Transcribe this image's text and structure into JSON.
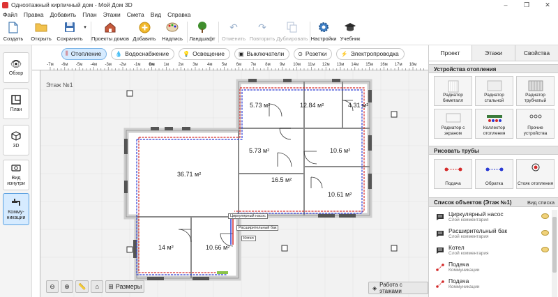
{
  "window": {
    "title": "Одноэтажный кирпичный дом - Мой Дом 3D",
    "controls": [
      "–",
      "❐",
      "✕"
    ]
  },
  "menu": [
    "Файл",
    "Правка",
    "Добавить",
    "План",
    "Этажи",
    "Смета",
    "Вид",
    "Справка"
  ],
  "toolbar": {
    "create": "Создать",
    "open": "Открыть",
    "save": "Сохранить",
    "house_projects": "Проекты домов",
    "add": "Добавить",
    "label": "Надпись",
    "landscape": "Ландшафт",
    "undo": "Отменить",
    "redo": "Повторить",
    "duplicate": "Дублировать",
    "settings": "Настройки",
    "tutorial": "Учебник"
  },
  "leftnav": {
    "overview": "Обзор",
    "plan": "План",
    "view3d": "3D",
    "view_inside": "Вид изнутри",
    "communications": "Комму-никации"
  },
  "categories": [
    "Отопление",
    "Водоснабжение",
    "Освещение",
    "Выключатели",
    "Розетки",
    "Электропроводка"
  ],
  "canvas": {
    "floor_label": "Этаж №1",
    "ruler_labels": [
      "-7м",
      "-6м",
      "-5м",
      "-4м",
      "-3м",
      "-2м",
      "-1м",
      "0м",
      "1м",
      "2м",
      "3м",
      "4м",
      "5м",
      "6м",
      "7м",
      "8м",
      "9м",
      "10м",
      "11м",
      "12м",
      "13м",
      "14м",
      "15м",
      "16м",
      "17м",
      "18м"
    ],
    "rooms": [
      "5.73 м²",
      "12.84 м²",
      "4.31 м²",
      "36.71 м²",
      "5.73 м²",
      "10.6 м²",
      "16.5 м²",
      "10.61 м²",
      "14 м²",
      "10.66 м²"
    ],
    "tags": [
      "Циркулярный насос",
      "Расширительный бак",
      "Котел"
    ],
    "sizes_button": "Размеры",
    "floors_button": "Работа с этажами"
  },
  "rpanel": {
    "tabs": [
      "Проект",
      "Этажи",
      "Свойства"
    ],
    "heating_header": "Устройства отопления",
    "heating_tiles": [
      "Радиатор биметалл",
      "Радиатор стальной",
      "Радиатор трубчатый",
      "Радиатор с экраном",
      "Коллектор отопления",
      "Прочие устройства"
    ],
    "pipes_header": "Рисовать трубы",
    "pipes_tiles": [
      "Подача",
      "Обратка",
      "Стояк отопления"
    ],
    "objects_header": "Список объектов (Этаж №1)",
    "objects_view": "Вид списка",
    "objects": [
      {
        "name": "Циркулярный насос",
        "sub": "Слой комментария"
      },
      {
        "name": "Расширительный бак",
        "sub": "Слой комментария"
      },
      {
        "name": "Котел",
        "sub": "Слой комментария"
      },
      {
        "name": "Подача",
        "sub": "Коммуникации"
      },
      {
        "name": "Подача",
        "sub": "Коммуникации"
      }
    ]
  },
  "colors": {
    "accent": "#d6ebff",
    "supply_pipe": "#d42a2a",
    "return_pipe": "#2a3ad4"
  }
}
